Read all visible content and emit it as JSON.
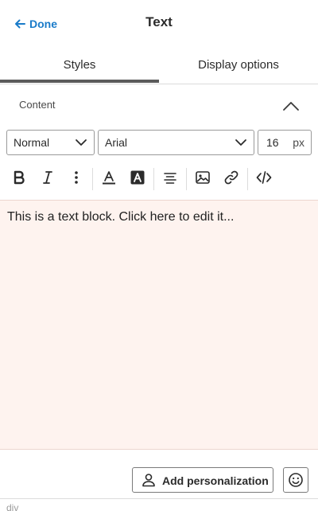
{
  "header": {
    "done_label": "Done",
    "title": "Text"
  },
  "tabs": [
    {
      "label": "Styles",
      "active": true
    },
    {
      "label": "Display options",
      "active": false
    }
  ],
  "content_section": {
    "label": "Content",
    "expanded": true
  },
  "format": {
    "block_style": "Normal",
    "font_family": "Arial",
    "font_size": "16",
    "font_size_unit": "px"
  },
  "toolbar": {
    "tools": [
      "bold-icon",
      "italic-icon",
      "more-vertical-icon",
      "text-color-icon",
      "highlight-color-icon",
      "align-center-icon",
      "image-icon",
      "link-icon",
      "code-icon"
    ]
  },
  "editor": {
    "text": "This is a text block. Click here to edit it..."
  },
  "actions": {
    "personalization_label": "Add personalization",
    "emoji_icon": "smiley-icon"
  },
  "statusbar": {
    "path": "div"
  },
  "colors": {
    "accent": "#1a7bc9",
    "editor_bg": "#fef3ef",
    "tab_indicator": "#5b5b5b"
  }
}
